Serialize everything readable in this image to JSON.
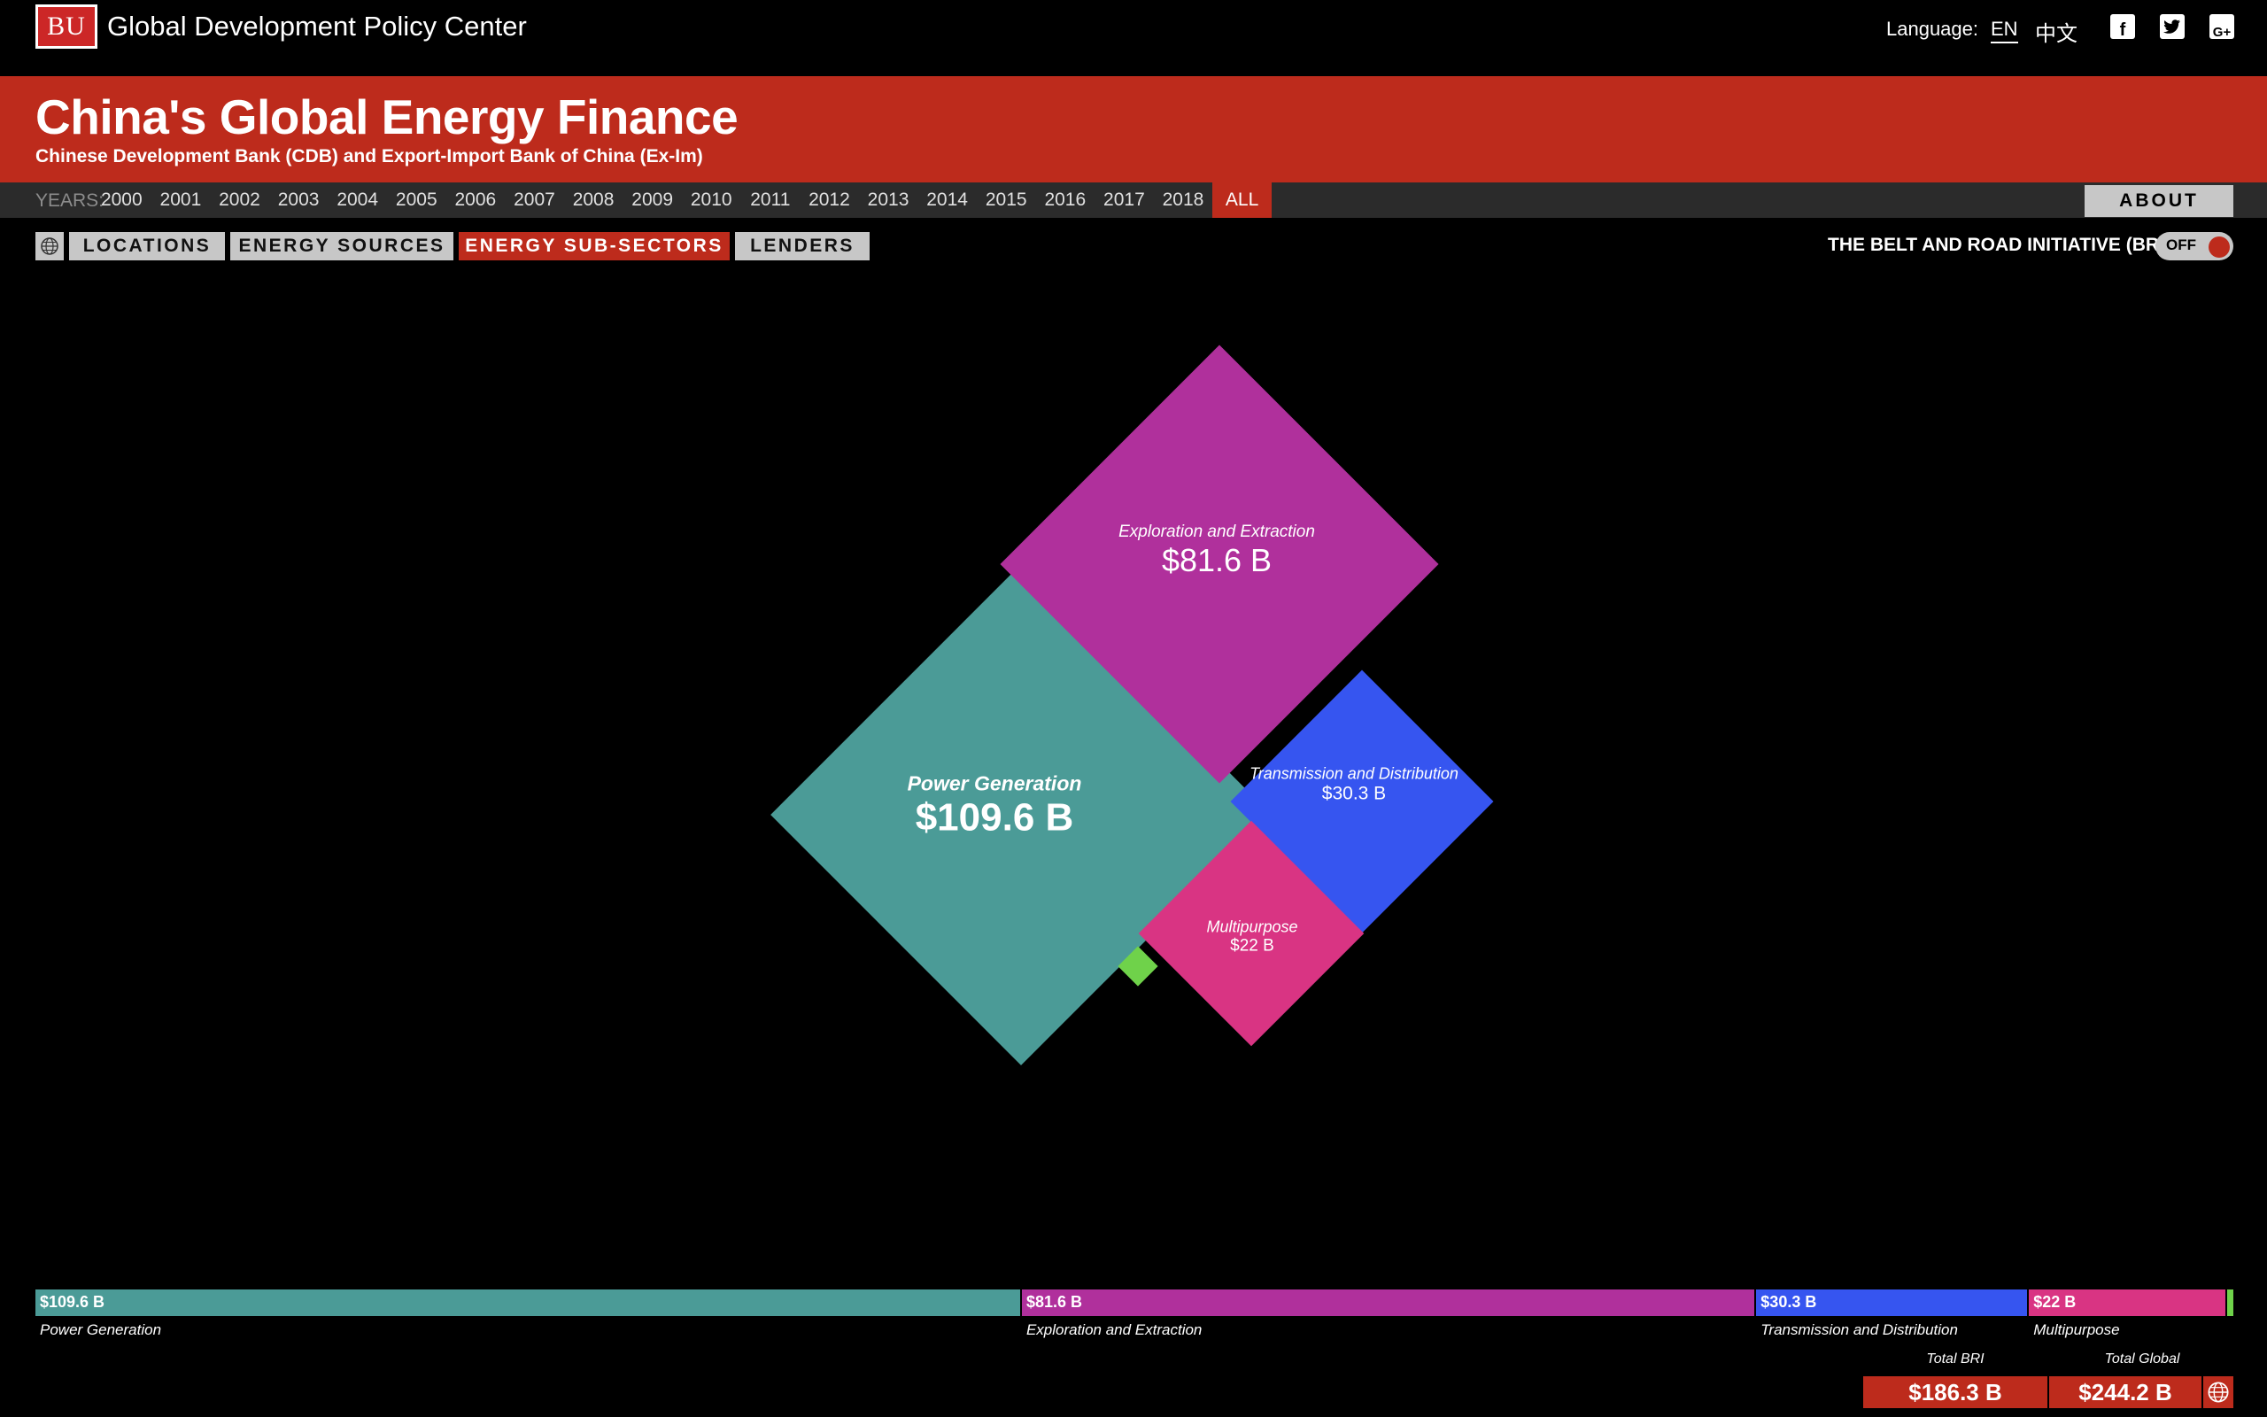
{
  "topbar": {
    "logo_text": "BU",
    "org_name": "Global Development Policy Center",
    "language_label": "Language:",
    "lang_en": "EN",
    "lang_zh": "中文",
    "social_icons": [
      "facebook-icon",
      "twitter-icon",
      "googleplus-icon"
    ]
  },
  "header": {
    "title": "China's Global Energy Finance",
    "subtitle": "Chinese Development Bank (CDB) and Export-Import Bank of China (Ex-Im)"
  },
  "years": {
    "label": "YEARS:",
    "items": [
      "2000",
      "2001",
      "2002",
      "2003",
      "2004",
      "2005",
      "2006",
      "2007",
      "2008",
      "2009",
      "2010",
      "2011",
      "2012",
      "2013",
      "2014",
      "2015",
      "2016",
      "2017",
      "2018",
      "ALL"
    ],
    "selected": "ALL",
    "about_label": "ABOUT"
  },
  "views": {
    "tabs": [
      "LOCATIONS",
      "ENERGY SOURCES",
      "ENERGY SUB-SECTORS",
      "LENDERS"
    ],
    "selected": "ENERGY SUB-SECTORS",
    "bri_label": "THE BELT AND ROAD INITIATIVE (BRI)",
    "bri_toggle": "OFF"
  },
  "colors": {
    "brand_red": "#bd2b1c",
    "power_generation": "#4b9b97",
    "exploration_extraction": "#b0309c",
    "transmission_distribution": "#3655f0",
    "multipurpose": "#d93483",
    "other": "#6fd24a"
  },
  "chart_data": {
    "type": "treemap",
    "unit": "$ B",
    "sectors": [
      {
        "name": "Power Generation",
        "value": 109.6,
        "label": "$109.6 B",
        "color": "#4b9b97"
      },
      {
        "name": "Exploration and Extraction",
        "value": 81.6,
        "label": "$81.6 B",
        "color": "#b0309c"
      },
      {
        "name": "Transmission and Distribution",
        "value": 30.3,
        "label": "$30.3 B",
        "color": "#3655f0"
      },
      {
        "name": "Multipurpose",
        "value": 22,
        "label": "$22 B",
        "color": "#d93483"
      },
      {
        "name": "",
        "value": 0.7,
        "label": "",
        "color": "#6fd24a"
      }
    ]
  },
  "totals": {
    "bri_label": "Total BRI",
    "bri_value": "$186.3 B",
    "global_label": "Total Global",
    "global_value": "$244.2 B"
  }
}
